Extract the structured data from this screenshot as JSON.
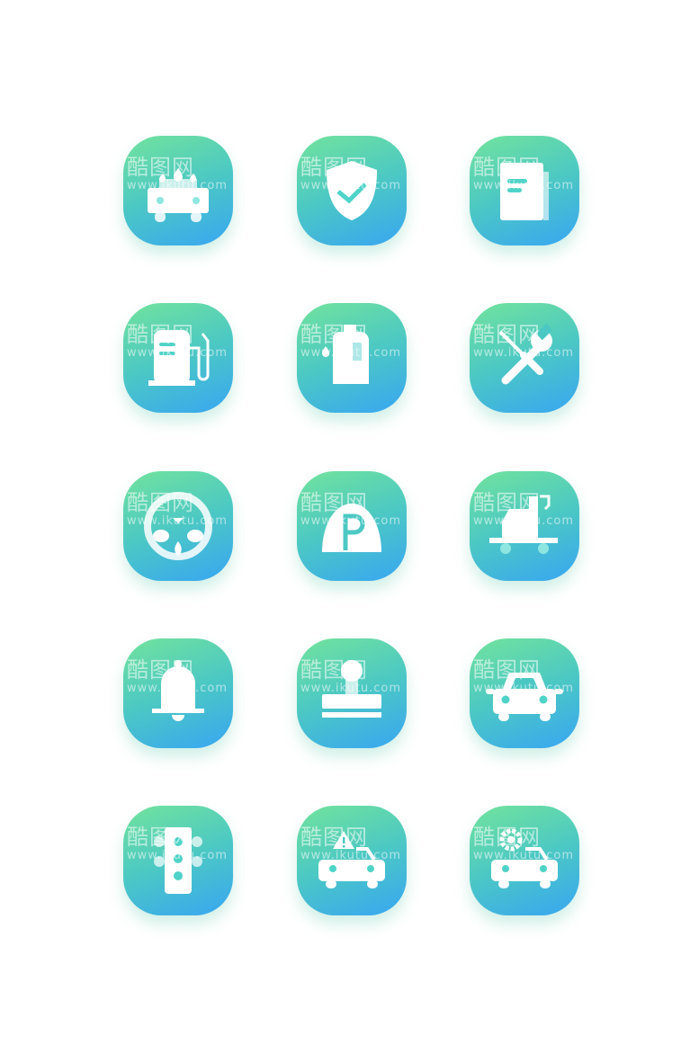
{
  "colors": {
    "gradient_start": "#72e39c",
    "gradient_end": "#38a6f2",
    "glyph": "#ffffff",
    "accent": "#4fd3c8"
  },
  "watermark": {
    "logo_text": "酷图网",
    "url": "www.ikutu.com"
  },
  "icons": [
    {
      "name": "car-wash-icon"
    },
    {
      "name": "shield-check-icon"
    },
    {
      "name": "document-icon"
    },
    {
      "name": "fuel-pump-icon"
    },
    {
      "name": "oil-can-icon"
    },
    {
      "name": "wrench-screwdriver-icon"
    },
    {
      "name": "steering-wheel-icon"
    },
    {
      "name": "parking-icon"
    },
    {
      "name": "tow-truck-icon"
    },
    {
      "name": "bell-icon"
    },
    {
      "name": "stamp-icon"
    },
    {
      "name": "car-icon"
    },
    {
      "name": "traffic-light-icon"
    },
    {
      "name": "car-warning-icon"
    },
    {
      "name": "car-settings-icon"
    }
  ]
}
